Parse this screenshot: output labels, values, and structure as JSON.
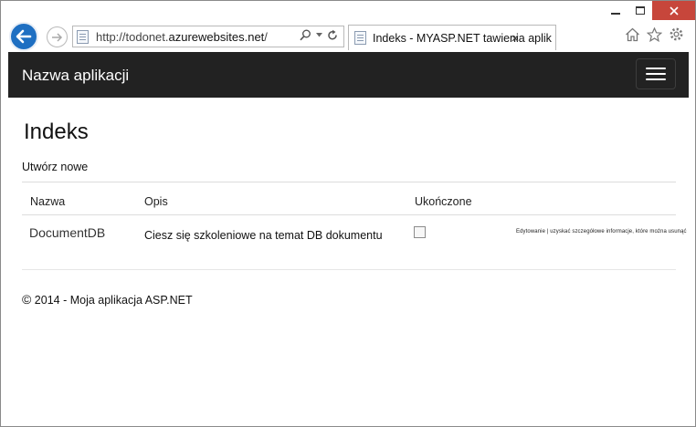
{
  "browser": {
    "url_prefix": "http://todonet.",
    "url_host": "azurewebsites.net",
    "url_suffix": "/",
    "tab_title": "Indeks - MYASP.NET tawienia aplikacji."
  },
  "navbar": {
    "brand": "Nazwa aplikacji"
  },
  "page": {
    "title": "Indeks",
    "create_link": "Utwórz nowe",
    "table": {
      "headers": [
        "Nazwa",
        "Opis",
        "Ukończone"
      ],
      "rows": [
        {
          "name": "DocumentDB",
          "description": "Ciesz się szkoleniowe na temat DB dokumentu",
          "completed": false,
          "actions": "Edytowanie | uzyskać szczegółowe informacje, które można usunąć"
        }
      ]
    },
    "footer": {
      "copyright_symbol": "©",
      "text": " 2014 - Moja aplikacja ASP.NET"
    }
  },
  "colors": {
    "navbar_bg": "#222222",
    "back_button": "#1e6fc2",
    "close_button": "#c7463b"
  },
  "icons": [
    "back-arrow-icon",
    "forward-arrow-icon",
    "page-icon",
    "search-icon",
    "dropdown-icon",
    "refresh-icon",
    "home-icon",
    "favorites-star-icon",
    "settings-gear-icon",
    "close-icon",
    "hamburger-menu-icon"
  ]
}
